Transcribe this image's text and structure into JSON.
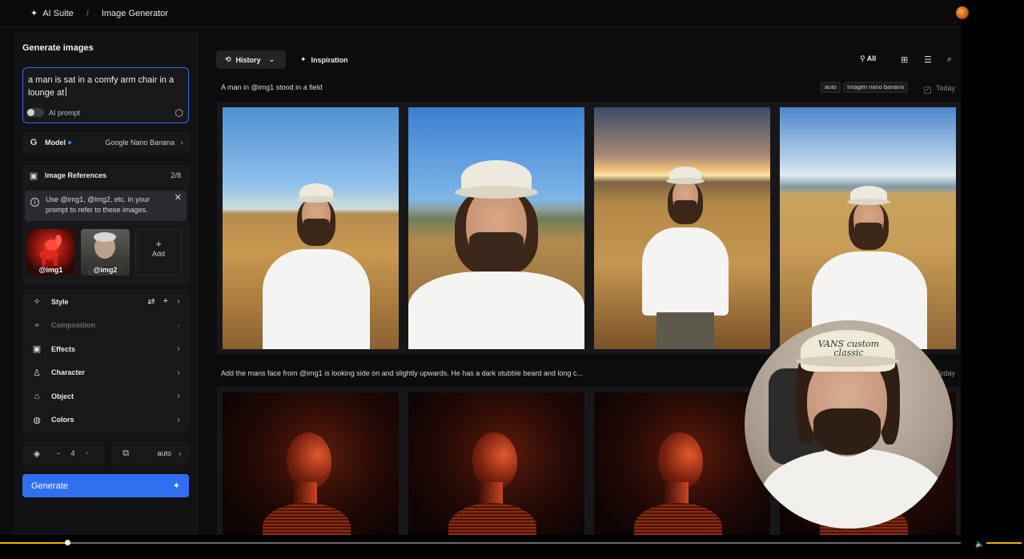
{
  "topbar": {
    "app_name": "AI Suite",
    "separator": "/",
    "page_name": "Image Generator"
  },
  "sidebar": {
    "title": "Generate images",
    "prompt_value": "a man is sat in a comfy arm chair in a lounge at",
    "ai_prompt_label": "AI prompt",
    "ai_prompt_enabled": false,
    "model": {
      "label": "Model",
      "value": "Google Nano Banana"
    },
    "image_references": {
      "label": "Image References",
      "count": "2/8",
      "info_text": "Use @img1, @img2, etc. in your prompt to refer to these images.",
      "items": [
        {
          "tag": "@img1"
        },
        {
          "tag": "@img2"
        }
      ],
      "add_label": "Add"
    },
    "settings": [
      {
        "label": "Style"
      },
      {
        "label": "Composition"
      },
      {
        "label": "Effects"
      },
      {
        "label": "Character"
      },
      {
        "label": "Object"
      },
      {
        "label": "Colors"
      }
    ],
    "count_value": "4",
    "aspect_value": "auto",
    "generate_label": "Generate"
  },
  "main": {
    "tabs": [
      {
        "label": "History"
      },
      {
        "label": "Inspiration"
      }
    ],
    "filter_label": "All",
    "groups": [
      {
        "caption": "A man in @img1 stood in a field",
        "tags": [
          "auto",
          "Imagen nano banana"
        ],
        "date": "Today"
      },
      {
        "caption": "Add the mans face from @img1 is looking side on and slightly upwards. He has a dark stubble beard and long c...",
        "date": "Today"
      }
    ]
  },
  "webcam": {
    "cap_text": "VANS custom classic"
  },
  "player": {
    "progress": 0.07
  },
  "colors": {
    "accent": "#2f6ff0",
    "focus_border": "#3b68e8",
    "progress": "#e3b400"
  }
}
